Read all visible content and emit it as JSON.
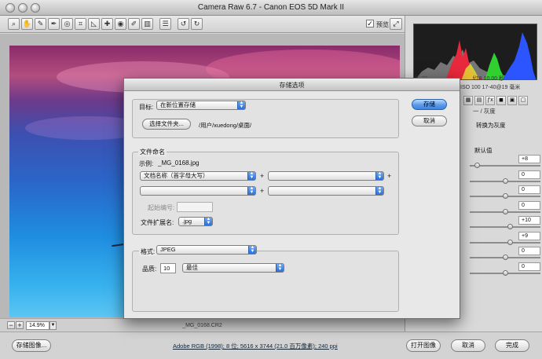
{
  "window": {
    "title": "Camera Raw 6.7  -  Canon EOS 5D Mark II"
  },
  "toolbar": {
    "tools": [
      {
        "icon": "zoom-icon",
        "glyph": "⌕"
      },
      {
        "icon": "hand-icon",
        "glyph": "✋"
      },
      {
        "icon": "white-balance-icon",
        "glyph": "✎"
      },
      {
        "icon": "color-sampler-icon",
        "glyph": "✒"
      },
      {
        "icon": "target-adjustment-icon",
        "glyph": "◎"
      },
      {
        "icon": "crop-icon",
        "glyph": "⌗"
      },
      {
        "icon": "straighten-icon",
        "glyph": "◺"
      },
      {
        "icon": "spot-removal-icon",
        "glyph": "✚"
      },
      {
        "icon": "red-eye-icon",
        "glyph": "◉"
      },
      {
        "icon": "adjustment-brush-icon",
        "glyph": "✐"
      },
      {
        "icon": "graduated-filter-icon",
        "glyph": "▥"
      },
      {
        "icon": "preferences-icon",
        "glyph": "☰"
      },
      {
        "icon": "rotate-left-icon",
        "glyph": "↺"
      },
      {
        "icon": "rotate-right-icon",
        "glyph": "↻"
      }
    ],
    "preview_label": "预览",
    "preview_checked": true
  },
  "statusbar": {
    "zoom": "14.9%",
    "filename": "_MG_0168.CR2"
  },
  "bottombar": {
    "save_image": "存储图像...",
    "workflow": "Adobe RGB (1998); 8 位; 5616 x 3744 (21.0 百万像素); 240 ppi",
    "open_image": "打开图像",
    "cancel": "取消",
    "done": "完成"
  },
  "rightpanel": {
    "rgb_label": "R:   ---",
    "exposure_info": "f/18   10.00 秒",
    "iso_info": "ISO 100   17-40@19 毫米",
    "header_partial": "一 / 灰度",
    "convert_gray": "转换为灰度",
    "default_label": "默认值",
    "slider_values": [
      "+8",
      "0",
      "0",
      "0",
      "+10",
      "+9",
      "0",
      "0"
    ]
  },
  "dialog": {
    "title": "存储选项",
    "target_label": "目标:",
    "target_value": "在新位置存储",
    "select_folder": "选择文件夹...",
    "folder_path": "/用户/xuedong/桌面/",
    "save_button": "存储",
    "cancel_button": "取消",
    "naming_title": "文件命名",
    "example_label": "示例:",
    "example_value": "_MG_0168.jpg",
    "naming_1": "文档名称（首字母大写）",
    "naming_2": "",
    "naming_3": "",
    "naming_4": "",
    "plus": "+",
    "start_number_label": "起始编号:",
    "extension_label": "文件扩展名:",
    "extension_value": ".jpg",
    "format_label": "格式:",
    "format_value": "JPEG",
    "quality_label": "品质:",
    "quality_value": "10",
    "quality_preset": "最佳"
  },
  "colors": {
    "accent_blue": "#3e84e0",
    "histogram_bg": "#1d1d1d"
  }
}
